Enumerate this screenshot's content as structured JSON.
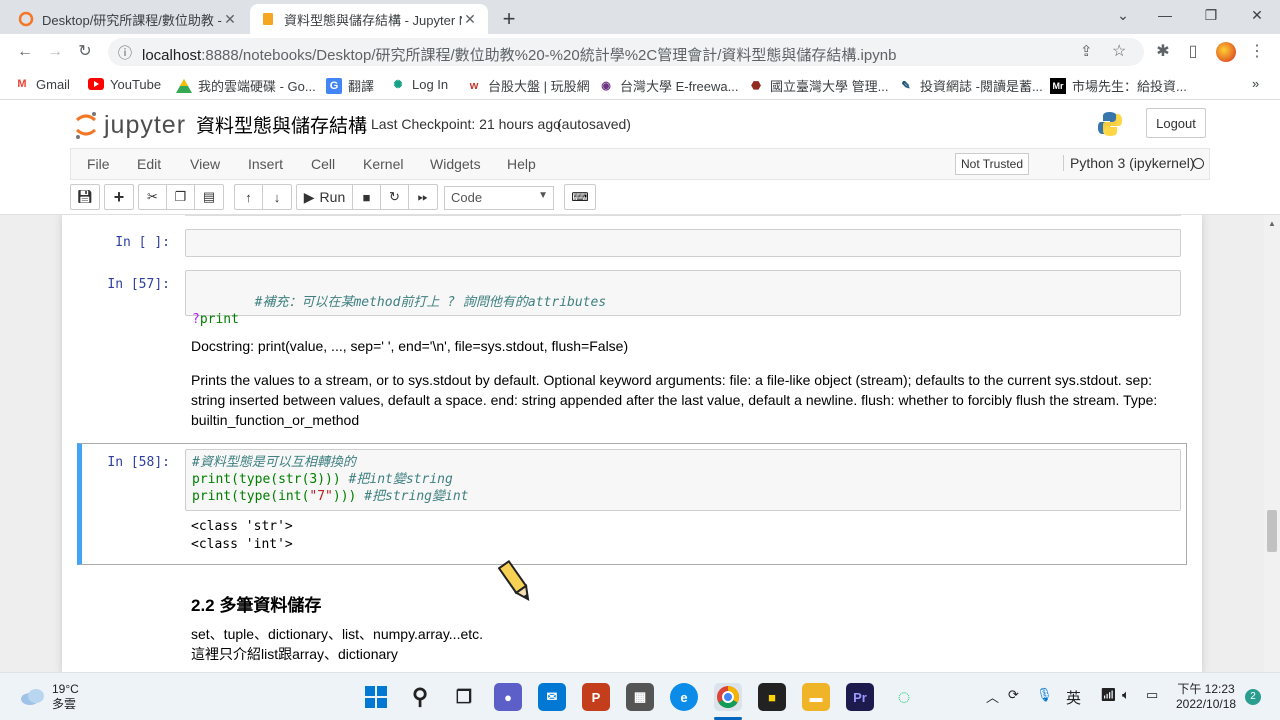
{
  "browser": {
    "tabs": [
      {
        "title": "Desktop/研究所課程/數位助教 -"
      },
      {
        "title": "資料型態與儲存結構 - Jupyter N"
      }
    ],
    "url_host": "localhost",
    "url_path": ":8888/notebooks/Desktop/研究所課程/數位助教%20-%20統計學%2C管理會計/資料型態與儲存結構.ipynb",
    "bookmarks": [
      "Gmail",
      "YouTube",
      "我的雲端硬碟 - Go...",
      "翻譯",
      "Log In",
      "台股大盤 | 玩股網",
      "台灣大學 E-freewa...",
      "國立臺灣大學 管理...",
      "投資網誌 -閱讀是蓄...",
      "市場先生：給投資..."
    ],
    "more": "»"
  },
  "jupyter": {
    "logo_text": "jupyter",
    "notebook_title": "資料型態與儲存結構",
    "checkpoint": "Last Checkpoint: 21 hours ago",
    "autosaved": "(autosaved)",
    "logout": "Logout",
    "menus": [
      "File",
      "Edit",
      "View",
      "Insert",
      "Cell",
      "Kernel",
      "Widgets",
      "Help"
    ],
    "trust": "Not Trusted",
    "kernel": "Python 3 (ipykernel)",
    "run_label": "Run",
    "cell_type": "Code"
  },
  "cells": {
    "c1": {
      "prompt": "In [ ]:"
    },
    "c2": {
      "prompt": "In [57]:",
      "line1": "#補充：可以在某method前打上 ? 詢問他有的attributes",
      "line2_mark": "?",
      "line2_rest": "print",
      "doc1": "Docstring: print(value, ..., sep=' ', end='\\n', file=sys.stdout, flush=False)",
      "doc2": "Prints the values to a stream, or to sys.stdout by default. Optional keyword arguments: file: a file-like object (stream); defaults to the current sys.stdout. sep: string inserted between values, default a space. end: string appended after the last value, default a newline. flush: whether to forcibly flush the stream. Type: builtin_function_or_method"
    },
    "c3": {
      "prompt": "In [58]:",
      "line1": "#資料型態是可以互相轉換的",
      "line2_code": "print(type(str(3)))",
      "line2_comment": "#把int變string",
      "line3_code_a": "print(type(int(",
      "line3_string": "\"7\"",
      "line3_code_b": ")))",
      "line3_comment": "#把string變int",
      "out1": "<class 'str'>",
      "out2": "<class 'int'>"
    },
    "md": {
      "heading": "2.2 多筆資料儲存",
      "p1": "set、tuple、dictionary、list、numpy.array...etc.",
      "p2": "這裡只介紹list跟array、dictionary"
    }
  },
  "taskbar": {
    "temp": "19°C",
    "weather": "多雲",
    "ime": "英",
    "time": "下午 12:23",
    "date": "2022/10/18",
    "notifications": "2"
  }
}
